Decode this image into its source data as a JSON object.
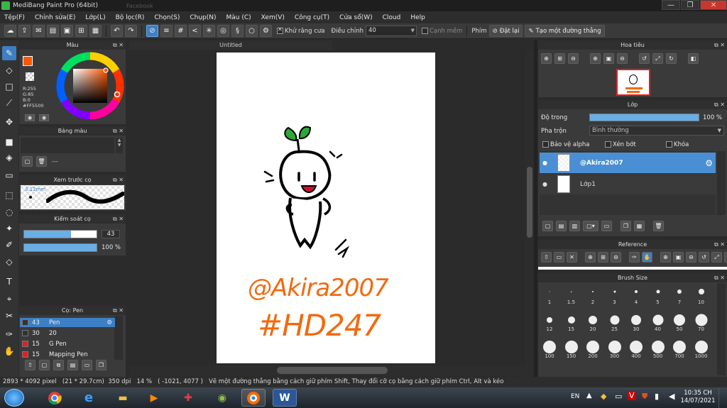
{
  "window": {
    "title": "MediBang Paint Pro (64bit)",
    "background_tab_hint": "Facebook",
    "minimize": "—",
    "maximize": "❐",
    "close": "✕"
  },
  "menu": [
    "Tệp(F)",
    "Chỉnh sửa(E)",
    "Lớp(L)",
    "Bộ lọc(R)",
    "Chọn(S)",
    "Chụp(N)",
    "Màu (C)",
    "Xem(V)",
    "Công cụ(T)",
    "Cửa sổ(W)",
    "Cloud",
    "Help"
  ],
  "toolbar": {
    "antialias_label": "Khử răng cưa",
    "correction_label": "Điều chỉnh",
    "correction_value": "40",
    "edge_label": "Cạnh mềm",
    "pen_label": "Phím",
    "reset_label": "Đặt lại",
    "straight_line_label": "Tạo một đường thẳng"
  },
  "color_panel": {
    "title": "Màu",
    "r": "R:255",
    "g": "G:85",
    "b": "B:0",
    "hex": "#FF5500",
    "primary_color": "#ff5500"
  },
  "palette_panel": {
    "title": "Bảng màu",
    "placeholder": "---"
  },
  "brush_preview": {
    "title": "Xem trước cọ",
    "size": "3.12mm"
  },
  "brush_control": {
    "title": "Kiểm soát cọ",
    "size_value": "43",
    "opacity_value": "100 %",
    "size_fraction": 0.65,
    "opacity_fraction": 1.0
  },
  "brush_list": {
    "title": "Cọ: Pen",
    "items": [
      {
        "size": "43",
        "name": "Pen",
        "color": "#333333",
        "selected": true
      },
      {
        "size": "30",
        "name": "20",
        "color": "#333333",
        "selected": false
      },
      {
        "size": "15",
        "name": "G Pen",
        "color": "#e02020",
        "selected": false
      },
      {
        "size": "15",
        "name": "Mapping Pen",
        "color": "#e02020",
        "selected": false
      }
    ]
  },
  "document": {
    "tab_title": "Untitled",
    "signature": "@Akira2007",
    "hashtag": "#HD247"
  },
  "navigator": {
    "title": "Hoa tiêu"
  },
  "layer_panel": {
    "title": "Lớp",
    "opacity_label": "Độ trong",
    "opacity_value": "100 %",
    "opacity_fraction": 1.0,
    "blend_label": "Pha trộn",
    "blend_value": "Bình thường",
    "protect_alpha": "Bảo vệ alpha",
    "clipping": "Xén bớt",
    "lock": "Khóa",
    "layers": [
      {
        "name": "@Akira2007",
        "selected": true
      },
      {
        "name": "Lớp1",
        "selected": false
      }
    ]
  },
  "reference_panel": {
    "title": "Reference"
  },
  "brush_size_panel": {
    "title": "Brush Size",
    "sizes": [
      "1",
      "1.5",
      "2",
      "3",
      "4",
      "5",
      "7",
      "10",
      "12",
      "15",
      "20",
      "25",
      "30",
      "40",
      "50",
      "70",
      "100",
      "150",
      "200",
      "300",
      "400",
      "500",
      "700",
      "1000"
    ]
  },
  "status_bar": {
    "dimensions": "2893 * 4092 pixel",
    "size_cm": "(21 * 29.7cm)",
    "dpi": "350 dpi",
    "zoom": "14 %",
    "cursor": "( -1021, 4077 )",
    "hint": "Vẽ một đường thẳng bằng cách giữ phím Shift, Thay đổi cỡ cọ bằng cách giữ phím Ctrl, Alt và kéo"
  },
  "taskbar": {
    "language": "EN",
    "time": "10:35 CH",
    "date": "14/07/2021"
  }
}
